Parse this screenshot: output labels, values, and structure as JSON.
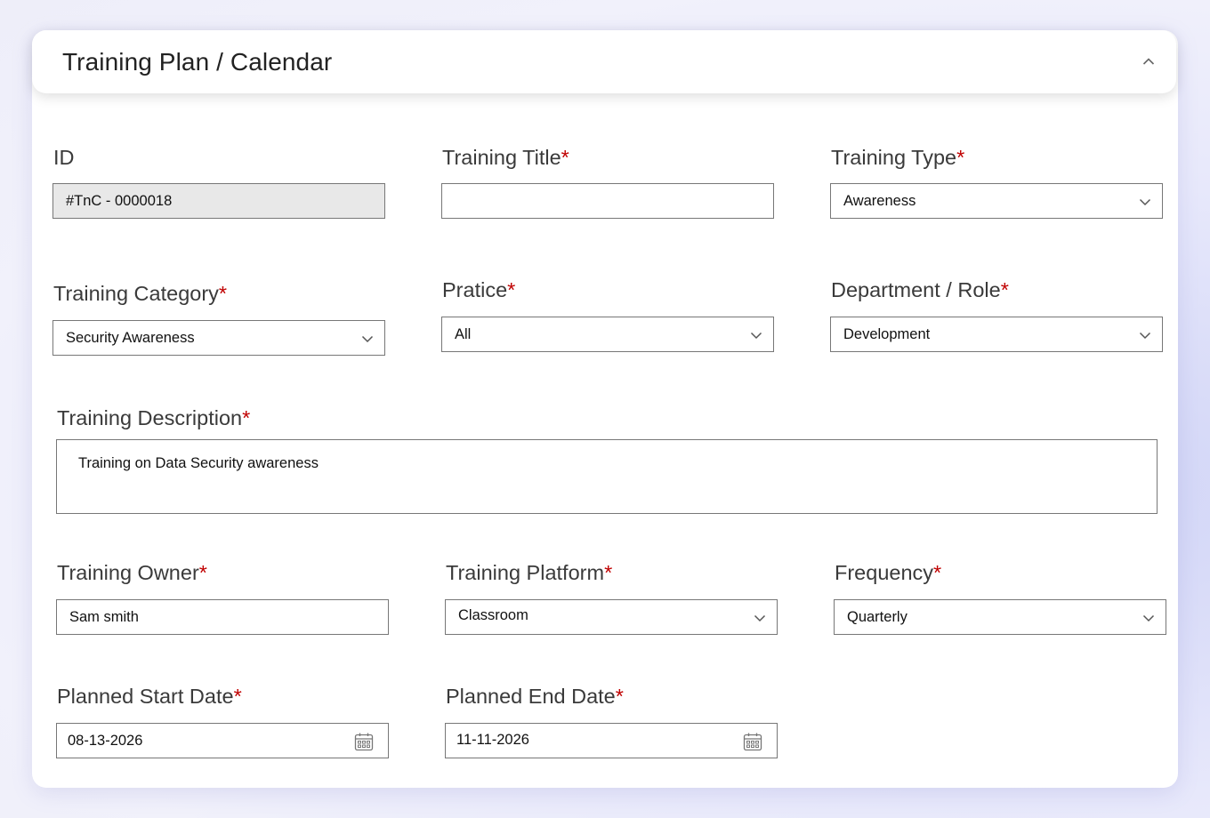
{
  "header": {
    "title": "Training Plan / Calendar"
  },
  "fields": {
    "id": {
      "label": "ID",
      "value": "#TnC - 0000018"
    },
    "title": {
      "label": "Training Title",
      "value": ""
    },
    "type": {
      "label": "Training Type",
      "value": "Awareness"
    },
    "category": {
      "label": "Training Category",
      "value": "Security Awareness"
    },
    "practice": {
      "label": "Pratice",
      "value": "All"
    },
    "department": {
      "label": "Department / Role",
      "value": "Development"
    },
    "description": {
      "label": "Training Description",
      "value": "Training on Data Security awareness"
    },
    "owner": {
      "label": "Training Owner",
      "value": "Sam smith"
    },
    "platform": {
      "label": "Training Platform",
      "value": "Classroom"
    },
    "frequency": {
      "label": "Frequency",
      "value": "Quarterly"
    },
    "start_date": {
      "label": "Planned Start Date",
      "value": "08-13-2026"
    },
    "end_date": {
      "label": "Planned End Date",
      "value": "11-11-2026"
    }
  },
  "required_marker": "*",
  "icons": {
    "collapse": "chevron-up-icon",
    "dropdown": "chevron-down-icon",
    "date": "calendar-icon"
  },
  "colors": {
    "required": "#c00000",
    "readonly_bg": "#e8e8e8",
    "border": "#777777"
  }
}
